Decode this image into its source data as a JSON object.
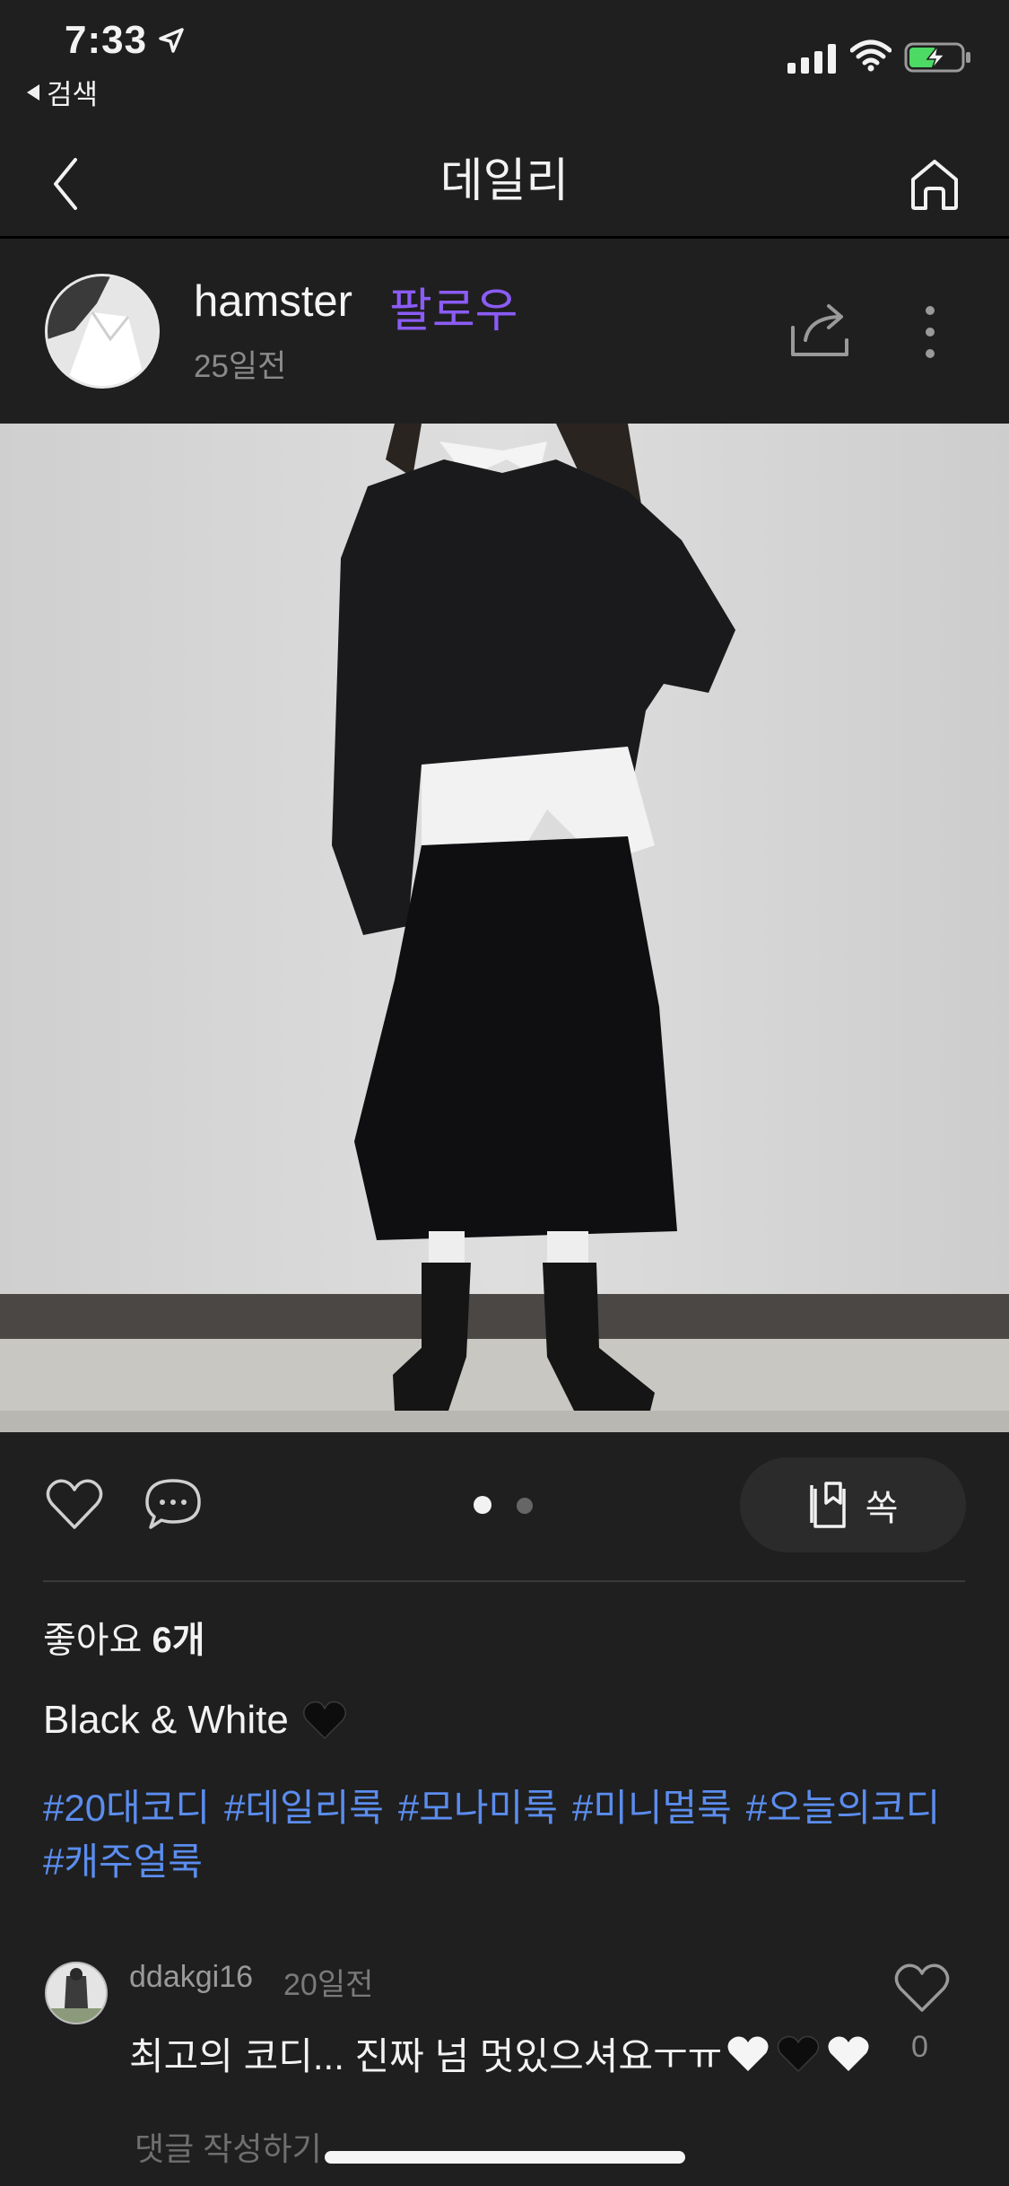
{
  "status_bar": {
    "time": "7:33",
    "back_app": "검색"
  },
  "nav": {
    "title": "데일리"
  },
  "post": {
    "username": "hamster",
    "follow_label": "팔로우",
    "time_ago": "25일전",
    "image_count": 2,
    "current_image": 1,
    "likes_prefix": "좋아요",
    "likes_count": "6개",
    "save_label": "쏙",
    "caption": "Black & White",
    "hashtags": [
      "#20대코디",
      "#데일리룩",
      "#모나미룩",
      "#미니멀룩",
      "#오늘의코디",
      "#캐주얼룩"
    ]
  },
  "comment": {
    "username": "ddakgi16",
    "time_ago": "20일전",
    "text": "최고의 코디... 진짜 넘 멋있으셔요ㅜㅠ",
    "like_count": "0"
  },
  "comment_input": {
    "placeholder": "댓글 작성하기"
  },
  "colors": {
    "background": "#1f1f1f",
    "follow": "#8b5cf6",
    "hashtag": "#5b8def",
    "battery": "#4cd964"
  }
}
